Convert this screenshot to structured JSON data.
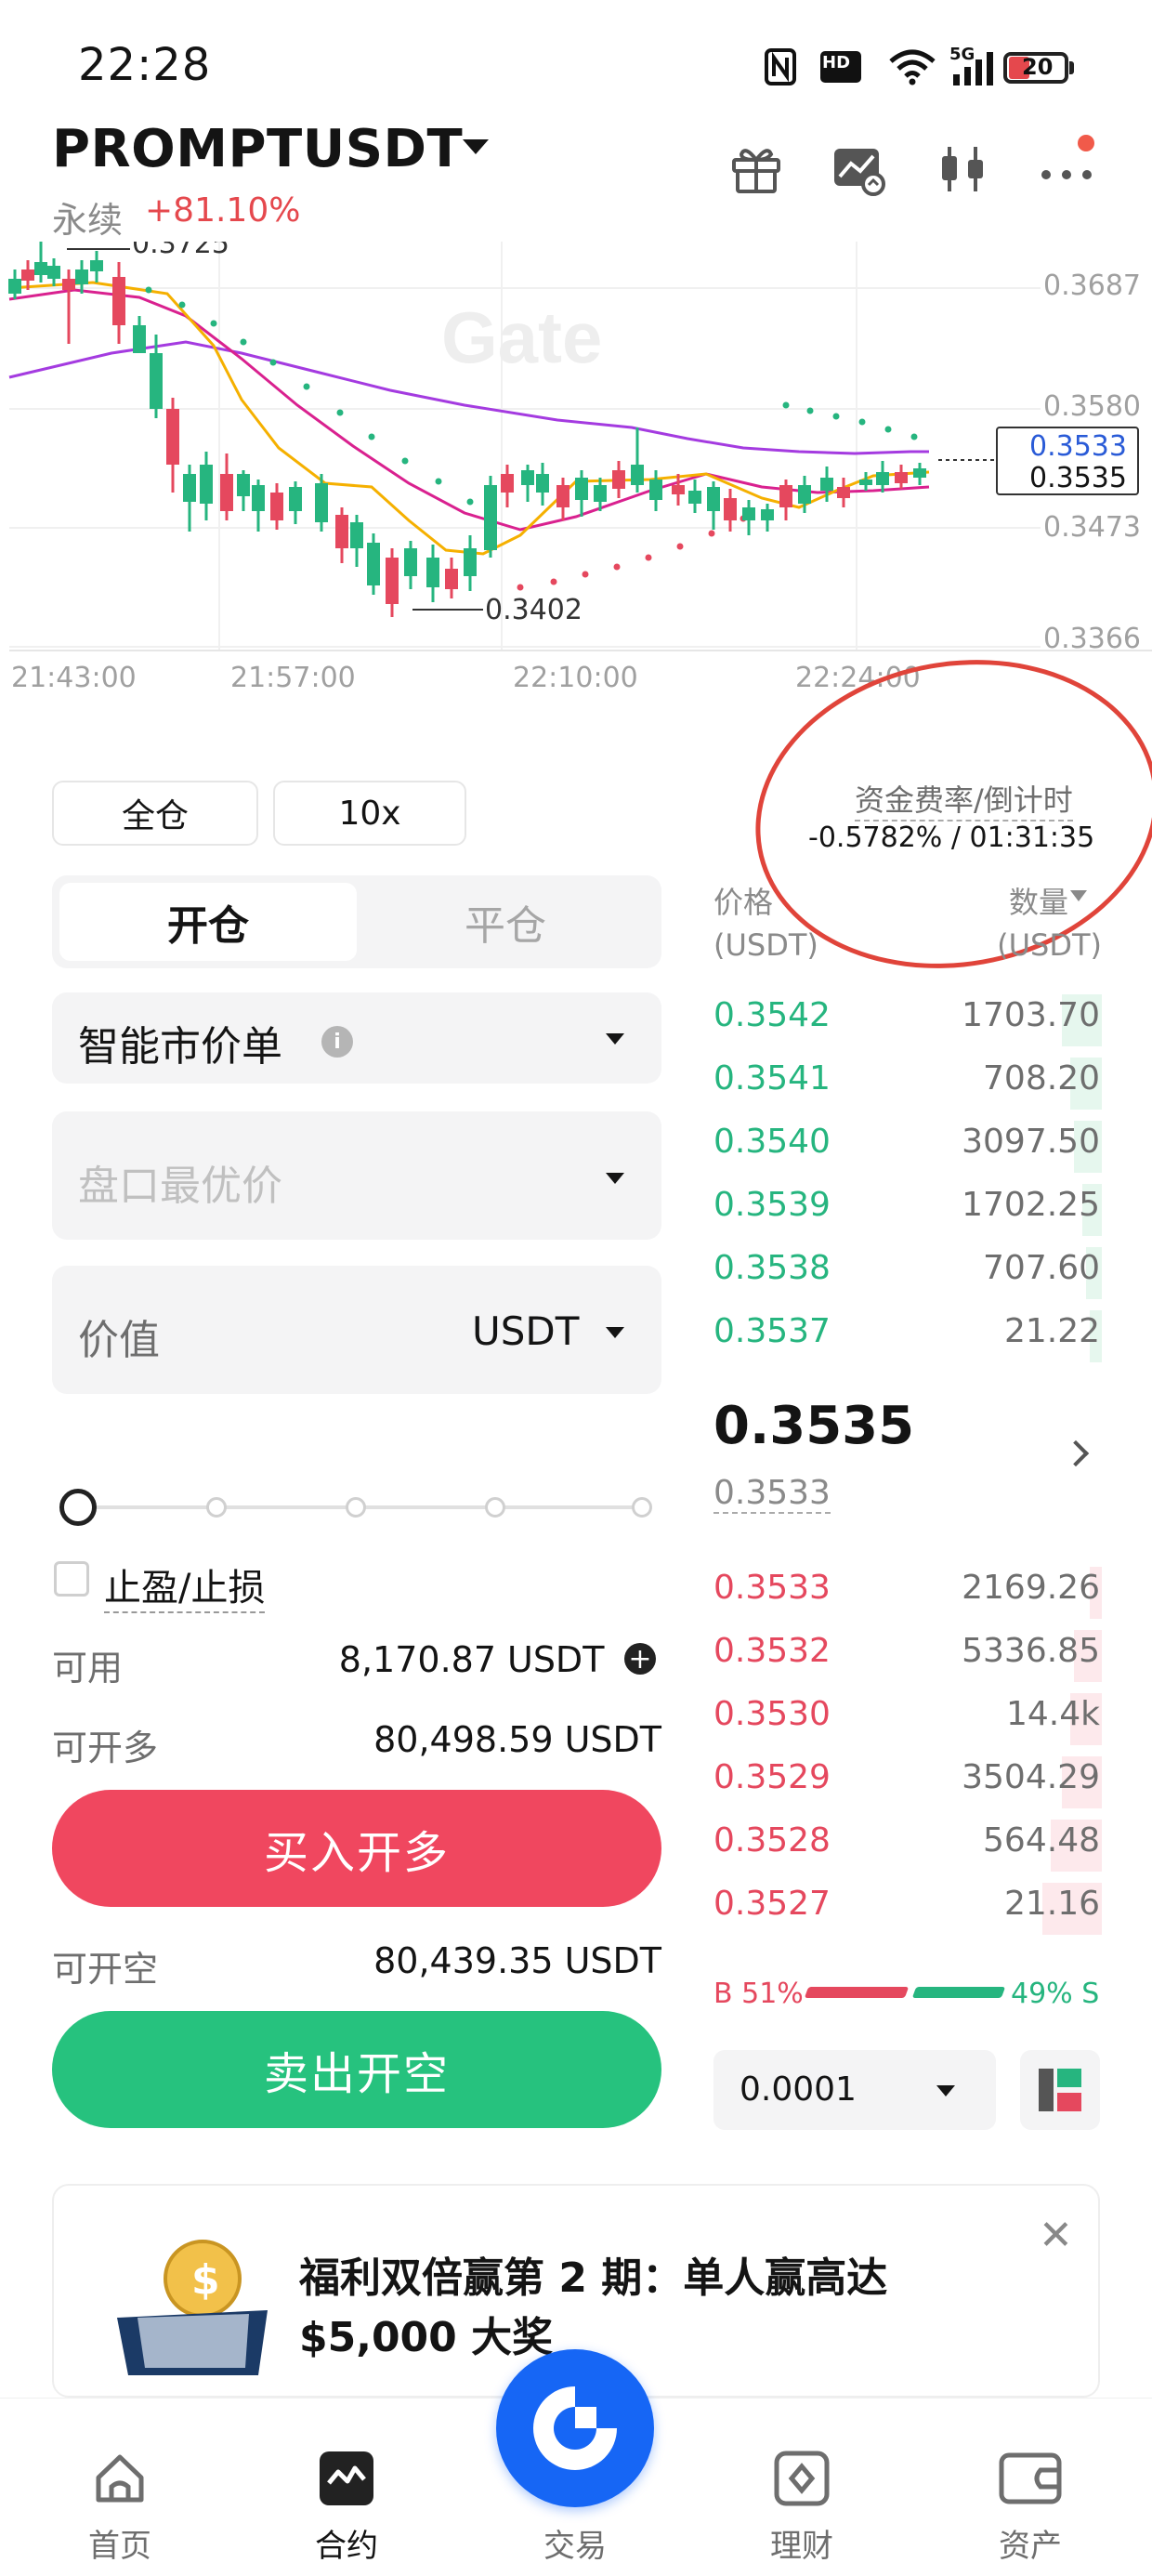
{
  "status_bar": {
    "time": "22:28",
    "icons": [
      "nfc-icon",
      "hd-icon",
      "wifi-icon",
      "signal-5g-icon",
      "signal-5g-icon",
      "battery-icon"
    ],
    "hd_label": "HD",
    "net_label_1": "5G",
    "net_label_2": "5G",
    "battery": "20"
  },
  "header": {
    "pair": "PROMPTUSDT",
    "contract_type": "永续",
    "change": "+81.10%",
    "icons": [
      "gift-icon",
      "chart-icon",
      "candles-icon",
      "more-icon"
    ]
  },
  "chart": {
    "watermark": "Gate",
    "price_ticks": [
      "0.3687",
      "0.3580",
      "0.3473",
      "0.3366"
    ],
    "time_ticks": [
      "21:43:00",
      "21:57:00",
      "22:10:00",
      "22:24:00"
    ],
    "high_label": "0.3725",
    "low_label": "0.3402",
    "last_blue": "0.3533",
    "last_black": "0.3535"
  },
  "order_form": {
    "margin_mode": "全仓",
    "leverage": "10x",
    "tab_open": "开仓",
    "tab_close": "平仓",
    "order_type": "智能市价单",
    "price_placeholder": "盘口最优价",
    "value_label": "价值",
    "value_unit": "USDT",
    "tpsl_label": "止盈/止损",
    "available_label": "可用",
    "available_value": "8,170.87",
    "available_unit": "USDT",
    "long_label": "可开多",
    "long_value": "80,498.59 USDT",
    "buy_label": "买入开多",
    "short_label": "可开空",
    "short_value": "80,439.35 USDT",
    "sell_label": "卖出开空"
  },
  "order_book": {
    "funding_label": "资金费率/倒计时",
    "funding_value": "-0.5782% / 01:31:35",
    "price_header": "价格",
    "price_unit": "(USDT)",
    "qty_header": "数量",
    "qty_unit": "(USDT)",
    "asks": [
      {
        "price": "0.3542",
        "qty": "1703.70",
        "depth": 0.1
      },
      {
        "price": "0.3541",
        "qty": "708.20",
        "depth": 0.08
      },
      {
        "price": "0.3540",
        "qty": "3097.50",
        "depth": 0.07
      },
      {
        "price": "0.3539",
        "qty": "1702.25",
        "depth": 0.05
      },
      {
        "price": "0.3538",
        "qty": "707.60",
        "depth": 0.04
      },
      {
        "price": "0.3537",
        "qty": "21.22",
        "depth": 0.03
      }
    ],
    "mid_price": "0.3535",
    "mark_price": "0.3533",
    "bids": [
      {
        "price": "0.3533",
        "qty": "2169.26",
        "depth": 0.03
      },
      {
        "price": "0.3532",
        "qty": "5336.85",
        "depth": 0.07
      },
      {
        "price": "0.3530",
        "qty": "14.4k",
        "depth": 0.08
      },
      {
        "price": "0.3529",
        "qty": "3504.29",
        "depth": 0.1
      },
      {
        "price": "0.3528",
        "qty": "564.48",
        "depth": 0.13
      },
      {
        "price": "0.3527",
        "qty": "21.16",
        "depth": 0.15
      }
    ],
    "buy_ratio": "B 51%",
    "sell_ratio": "49% S",
    "depth_step": "0.0001"
  },
  "promo": {
    "text": "福利双倍赢第 2 期：单人赢高达 $5,000 大奖"
  },
  "bottom_nav": {
    "home": "首页",
    "futures": "合约",
    "trade": "交易",
    "earn": "理财",
    "assets": "资产"
  },
  "colors": {
    "green": "#26b57f",
    "red": "#e5485e",
    "buy_button": "#f0475f",
    "sell_button": "#26c27e",
    "fab": "#1666f5"
  }
}
